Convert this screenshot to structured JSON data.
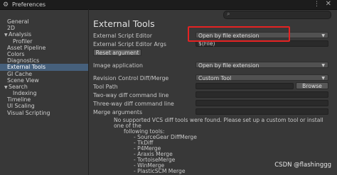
{
  "window": {
    "title": "Preferences",
    "more_glyph": "⋮",
    "close_glyph": "✕"
  },
  "search": {
    "icon": "search-icon"
  },
  "sidebar": {
    "items": [
      {
        "label": "General"
      },
      {
        "label": "2D"
      },
      {
        "label": "Analysis"
      },
      {
        "label": "Profiler"
      },
      {
        "label": "Asset Pipeline"
      },
      {
        "label": "Colors"
      },
      {
        "label": "Diagnostics"
      },
      {
        "label": "External Tools"
      },
      {
        "label": "GI Cache"
      },
      {
        "label": "Scene View"
      },
      {
        "label": "Search"
      },
      {
        "label": "Indexing"
      },
      {
        "label": "Timeline"
      },
      {
        "label": "UI Scaling"
      },
      {
        "label": "Visual Scripting"
      }
    ]
  },
  "main": {
    "heading": "External Tools",
    "external_script_editor": {
      "label": "External Script Editor",
      "value": "Open by file extension"
    },
    "external_script_editor_args": {
      "label": "External Script Editor Args",
      "value": "$(File)"
    },
    "reset_argument": "Reset argument",
    "image_application": {
      "label": "Image application",
      "value": "Open by file extension"
    },
    "revision_control": {
      "label": "Revision Control Diff/Merge",
      "value": "Custom Tool"
    },
    "tool_path": {
      "label": "Tool Path",
      "button": "Browse"
    },
    "two_way": {
      "label": "Two-way diff command line"
    },
    "three_way": {
      "label": "Three-way diff command line"
    },
    "merge_args": {
      "label": "Merge arguments"
    },
    "message": {
      "line1": "No supported VCS diff tools were found. Please set up a custom tool or install one of the",
      "line2": "following tools:",
      "tools": [
        "- SourceGear DiffMerge",
        "- TkDiff",
        "- P4Merge",
        "- Araxis Merge",
        "- TortoiseMerge",
        "- WinMerge",
        "- PlasticSCM Merge"
      ]
    }
  },
  "watermark": "CSDN @flashinggg",
  "colors": {
    "highlight": "#e52222",
    "selected": "#46607c"
  }
}
